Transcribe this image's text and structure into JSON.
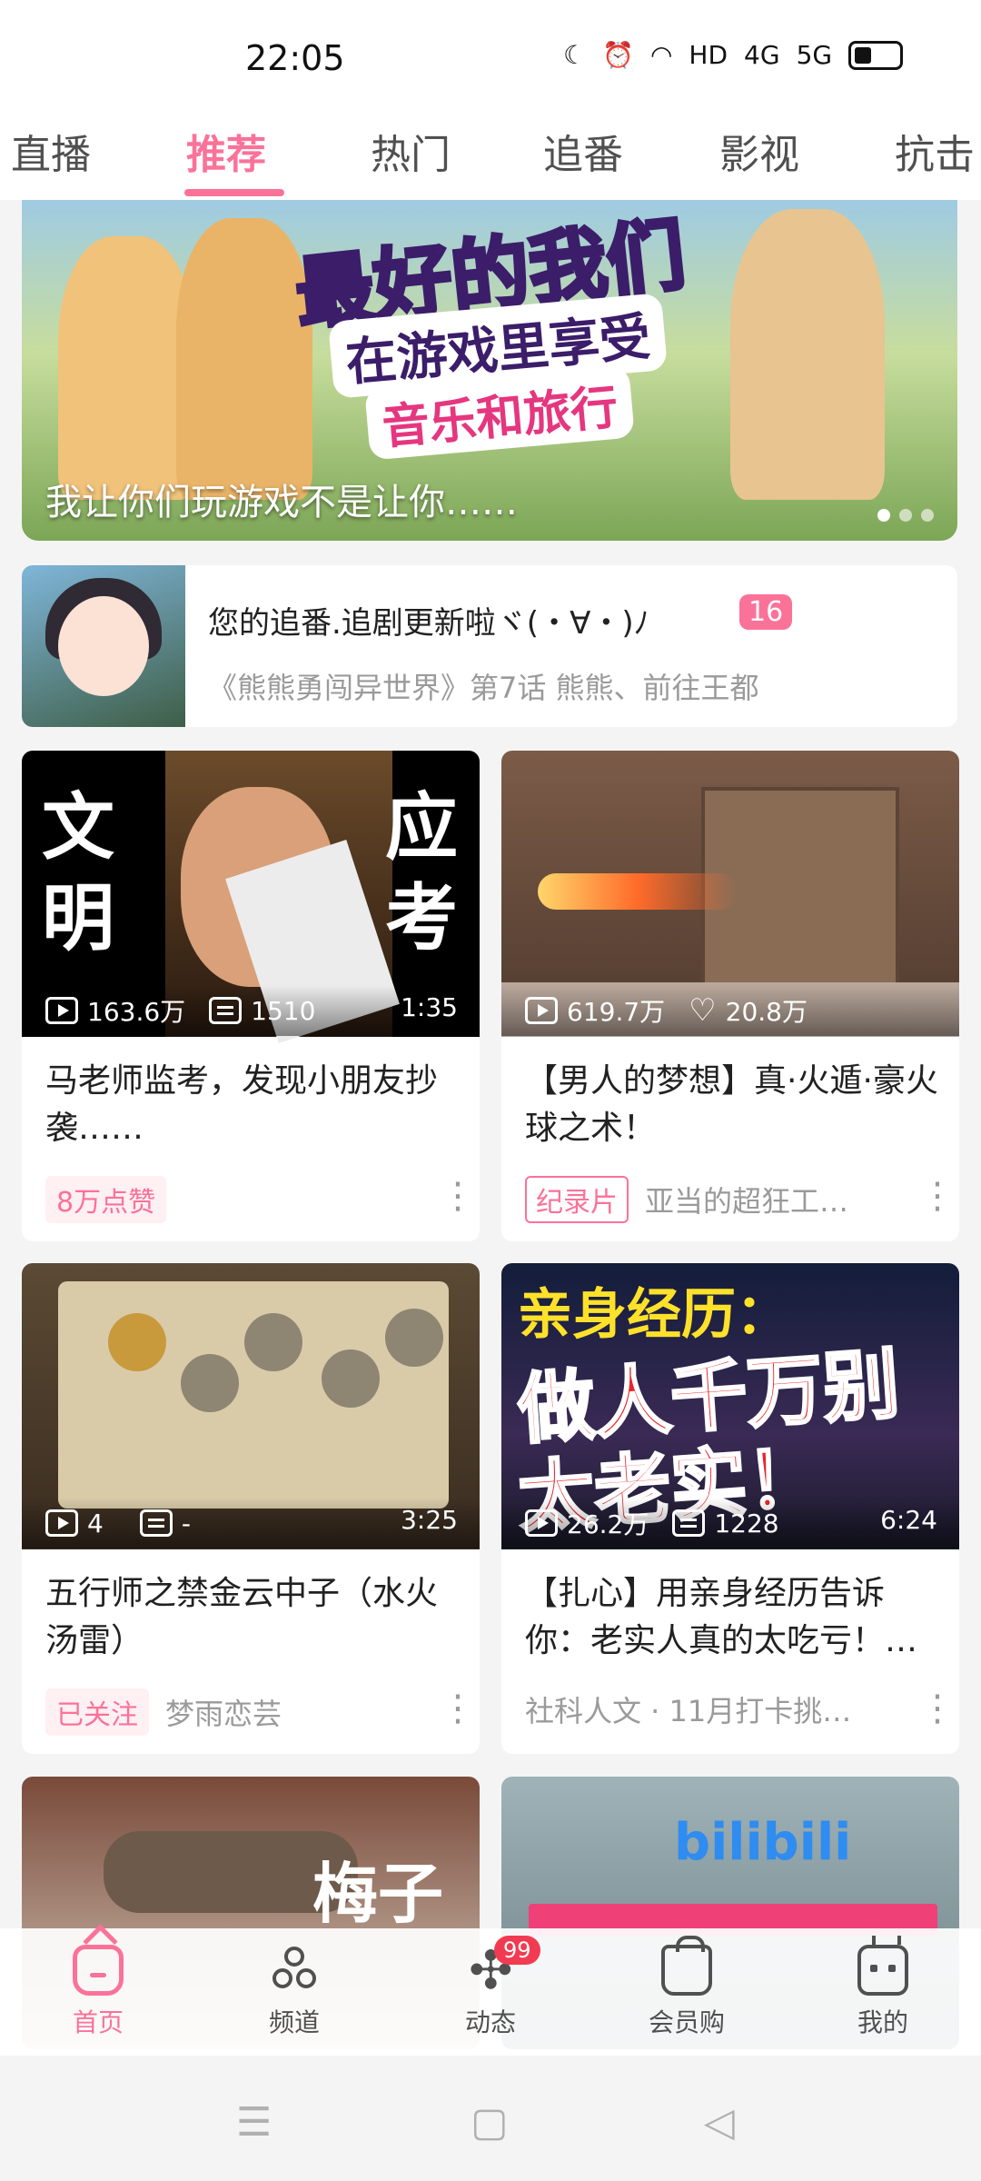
{
  "status_bar": {
    "time": "22:05",
    "icons": [
      "moon-icon",
      "alarm-icon",
      "wifi-icon",
      "HD",
      "4G",
      "5G",
      "battery-icon"
    ],
    "hd": "HD",
    "net4g": "4G",
    "net5g": "5G"
  },
  "tabs": [
    "直播",
    "推荐",
    "热门",
    "追番",
    "影视",
    "抗击"
  ],
  "active_tab": "推荐",
  "banner": {
    "title_line1": "最好的我们",
    "title_line2": "在游戏里享受",
    "title_line3": "音乐和旅行",
    "caption": "我让你们玩游戏不是让你……"
  },
  "follow_bar": {
    "title": "您的追番.追剧更新啦ヾ(・∀・)ﾉ",
    "count": "16",
    "subtitle": "《熊熊勇闯异世界》第7话 熊熊、前往王都"
  },
  "cards": [
    {
      "cover_text_left": [
        "文",
        "明"
      ],
      "cover_text_right": [
        "应",
        "考"
      ],
      "views": "163.6万",
      "second_stat": "1510",
      "second_stat_icon": "danmaku-icon",
      "duration": "1:35",
      "title": "马老师监考，发现小朋友抄袭……",
      "tag": "8万点赞",
      "tag_style": "fill",
      "author": ""
    },
    {
      "views": "619.7万",
      "second_stat": "20.8万",
      "second_stat_icon": "heart-icon",
      "duration": "",
      "title": "【男人的梦想】真·火遁·豪火球之术！",
      "tag": "纪录片",
      "tag_style": "line",
      "author": "亚当的超狂工…"
    },
    {
      "views": "4",
      "second_stat": "-",
      "second_stat_icon": "danmaku-icon",
      "duration": "3:25",
      "title": "五行师之禁金云中子（水火汤雷）",
      "tag": "已关注",
      "tag_style": "fill",
      "author": "梦雨恋芸"
    },
    {
      "cover_l1": "亲身经历：",
      "cover_l2": "做人千万别",
      "cover_l3": "太老实！",
      "views": "26.2万",
      "second_stat": "1228",
      "second_stat_icon": "danmaku-icon",
      "duration": "6:24",
      "title": "【扎心】用亲身经历告诉你：老实人真的太吃亏！…",
      "tag": "",
      "tag_style": "none",
      "author": "社科人文 · 11月打卡挑…"
    },
    {
      "cover_text": "梅子"
    },
    {
      "cover_text": "bilibili"
    }
  ],
  "bottom_nav": [
    {
      "label": "首页",
      "icon": "home-icon",
      "active": true
    },
    {
      "label": "频道",
      "icon": "channel-icon",
      "active": false
    },
    {
      "label": "动态",
      "icon": "dynamic-icon",
      "active": false,
      "badge": "99"
    },
    {
      "label": "会员购",
      "icon": "shopping-bag-icon",
      "active": false
    },
    {
      "label": "我的",
      "icon": "tv-icon",
      "active": false
    }
  ],
  "colors": {
    "accent": "#fb7299",
    "background": "#f4f4f4",
    "badge_red": "#f23b52"
  }
}
